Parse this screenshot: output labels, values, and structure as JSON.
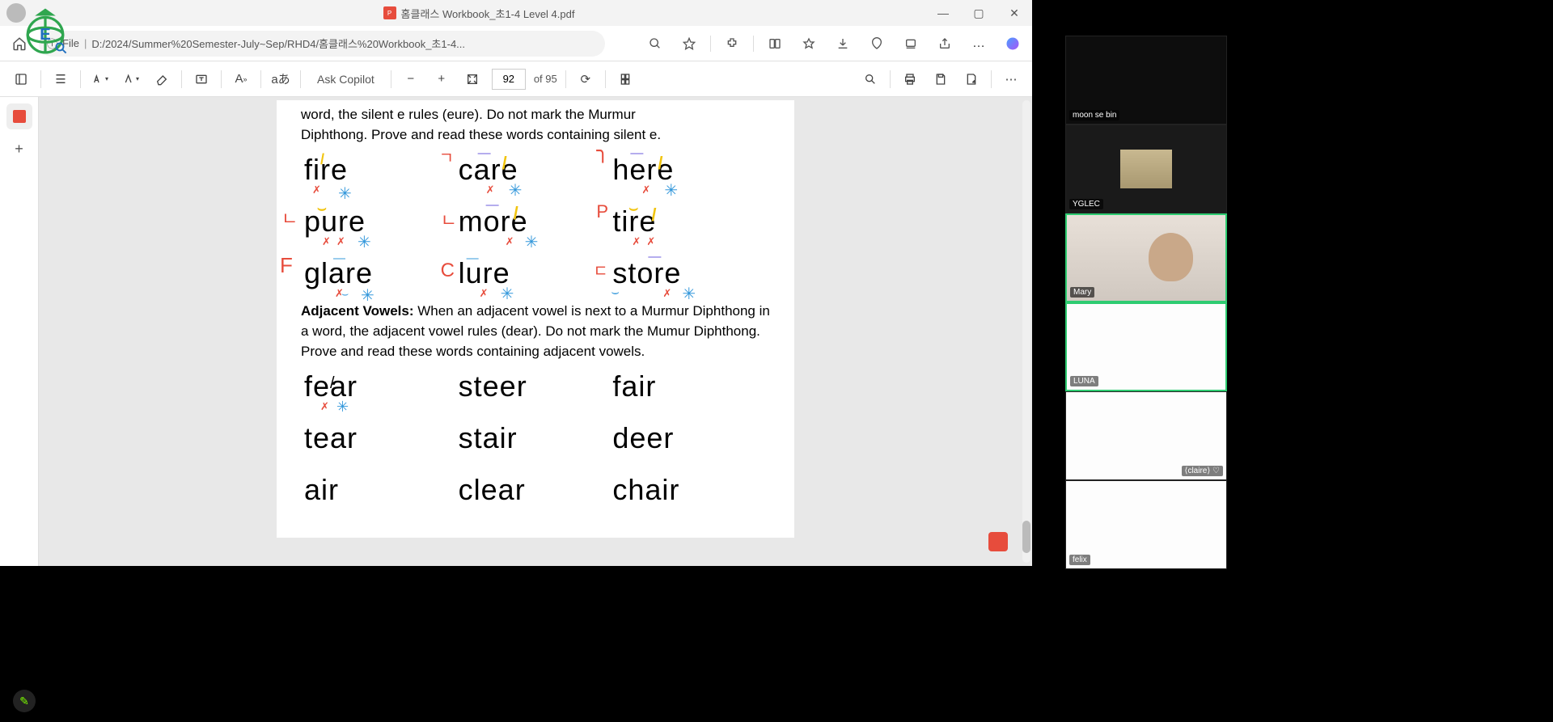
{
  "window": {
    "title": "홈클래스 Workbook_초1-4 Level 4.pdf",
    "min": "—",
    "max": "▢",
    "close": "✕"
  },
  "addressbar": {
    "scheme_icon": "ⓘ",
    "scheme": "File",
    "path": "D:/2024/Summer%20Semester-July~Sep/RHD4/홈클래스%20Workbook_초1-4...",
    "actions": {
      "zoom_info": "search-icon",
      "star": "star-icon",
      "ext": "extension-icon",
      "split": "split-screen-icon",
      "fav": "favorites-icon",
      "download": "download-icon",
      "browser_essentials": "heartshield-icon",
      "screenshot": "screenshot-icon",
      "share": "share-icon",
      "more": "…",
      "copilot_logo": "copilot-icon"
    }
  },
  "pdf_toolbar": {
    "toc": "☰",
    "highlight": "▽",
    "highlight2": "▽",
    "eraser": "◇",
    "textbox": "T",
    "readaloud": "A))",
    "translate": "aあ",
    "copilot": "Ask Copilot",
    "zoom_out": "−",
    "zoom_in": "+",
    "fit": "⿻",
    "page_current": "92",
    "page_total": "of 95",
    "rotate": "⟳",
    "view": "page-view-icon",
    "find": "search-icon",
    "print": "print-icon",
    "save": "save-icon",
    "saveas": "saveas-icon",
    "more": "⋯"
  },
  "document": {
    "para1_line1": "word, the silent e rules (eure). Do not mark the Murmur",
    "para1_line2": "Diphthong. Prove and read these words containing silent e.",
    "row1": {
      "a": "fire",
      "b": "care",
      "c": "here"
    },
    "row2": {
      "a": "pure",
      "b": "more",
      "c": "tire"
    },
    "row3": {
      "a": "glare",
      "b": "lure",
      "c": "store"
    },
    "adj_heading": "Adjacent Vowels:",
    "adj_body": " When an adjacent vowel is next to a Murmur Diphthong in a word, the adjacent vowel rules (dear). Do not mark the Mumur Diphthong. Prove and read these words containing adjacent vowels.",
    "row4": {
      "a": "fear",
      "b": "steer",
      "c": "fair"
    },
    "row5": {
      "a": "tear",
      "b": "stair",
      "c": "deer"
    },
    "row6": {
      "a": "air",
      "b": "clear",
      "c": "chair"
    }
  },
  "participants": [
    {
      "name": "moon se bin",
      "video": "off",
      "active": false
    },
    {
      "name": "YGLEC",
      "video": "thumb",
      "active": false
    },
    {
      "name": "Mary",
      "video": "face",
      "active": true
    },
    {
      "name": "LUNA",
      "video": "blank",
      "active": true
    },
    {
      "name": "⟨claire⟩ ♡",
      "video": "blank",
      "active": false
    },
    {
      "name": "felix",
      "video": "blank",
      "active": false
    }
  ]
}
